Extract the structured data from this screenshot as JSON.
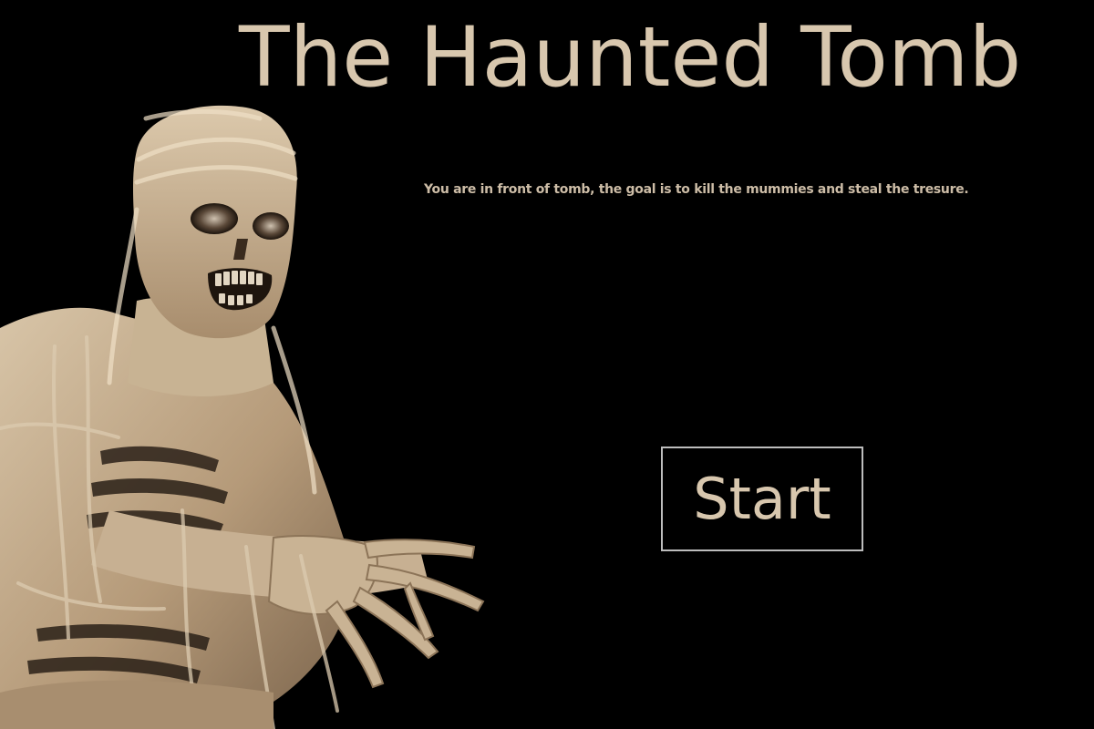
{
  "game": {
    "title": "The Haunted Tomb",
    "description": "You are in front of tomb, the goal is to kill the mummies and steal the tresure.",
    "start_label": "Start"
  },
  "colors": {
    "background": "#000000",
    "text": "#d8c7ae",
    "button_border": "#bdbdbd",
    "bandage_light": "#d6c3a6",
    "bandage_mid": "#b89e7e",
    "bandage_dark": "#6e5a45"
  },
  "art": {
    "character": "mummy"
  }
}
